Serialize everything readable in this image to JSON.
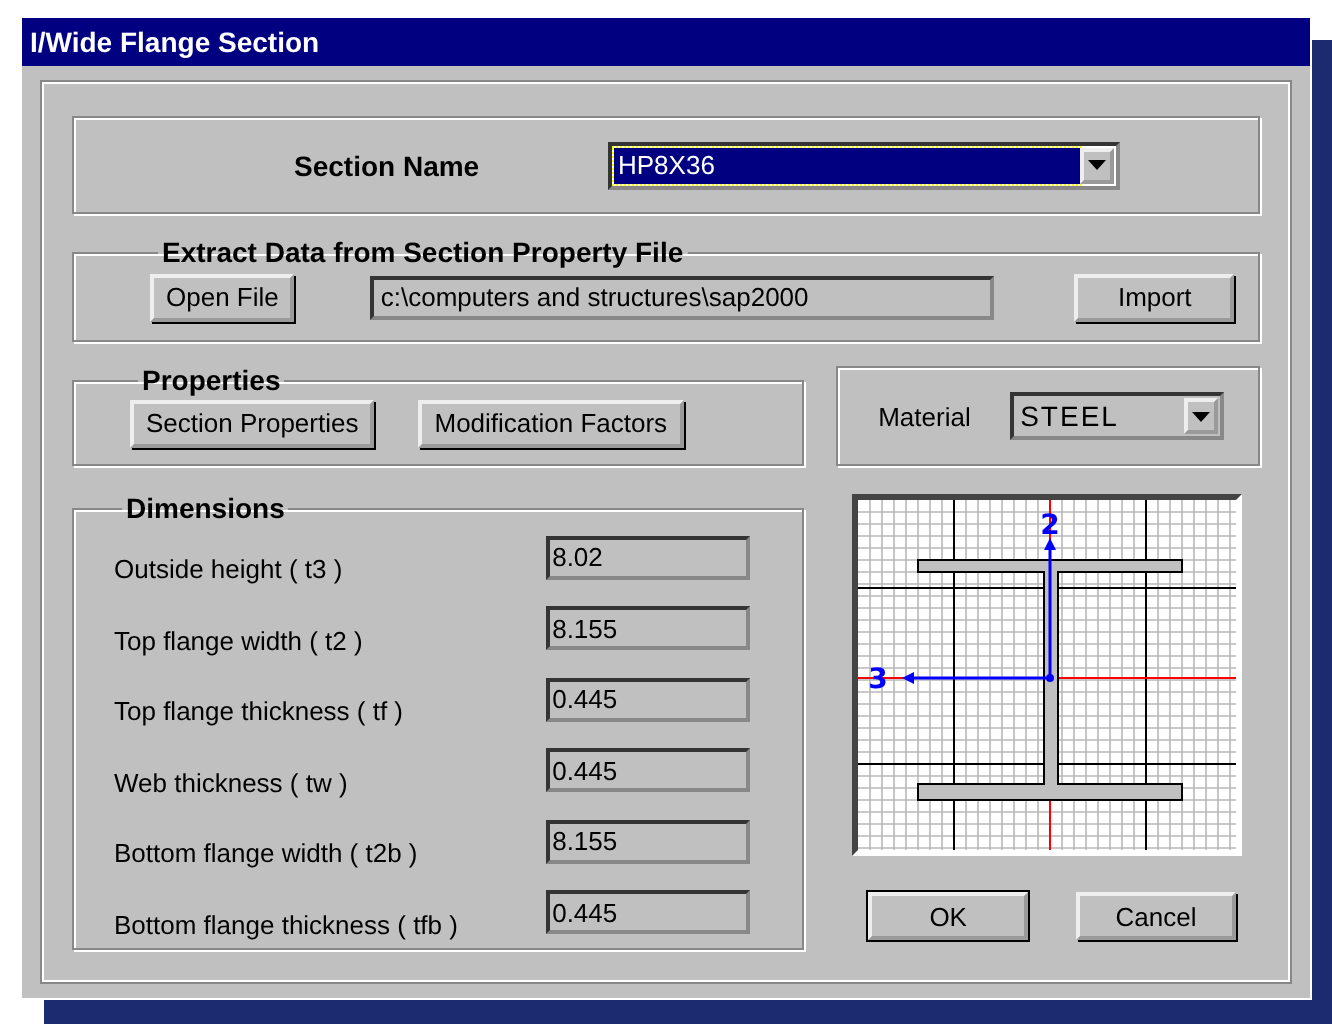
{
  "window": {
    "title": "I/Wide Flange Section"
  },
  "section_name": {
    "label": "Section Name",
    "value": "HP8X36",
    "focused": true
  },
  "extract": {
    "title": "Extract Data from Section Property File",
    "open_button": "Open File",
    "path": "c:\\computers and structures\\sap2000",
    "import_button": "Import"
  },
  "properties": {
    "title": "Properties",
    "buttons": [
      "Section Properties",
      "Modification Factors"
    ]
  },
  "material": {
    "label": "Material",
    "value": "STEEL"
  },
  "dimensions": {
    "title": "Dimensions",
    "rows": [
      {
        "label": "Outside height  ( t3 )",
        "value": "8.02"
      },
      {
        "label": "Top flange width  ( t2 )",
        "value": "8.155"
      },
      {
        "label": "Top flange thickness  ( tf )",
        "value": "0.445"
      },
      {
        "label": "Web thickness  ( tw )",
        "value": "0.445"
      },
      {
        "label": "Bottom flange width  ( t2b )",
        "value": "8.155"
      },
      {
        "label": "Bottom flange thickness  ( tfb )",
        "value": "0.445"
      }
    ]
  },
  "preview": {
    "axis_2": "2",
    "axis_3": "3"
  },
  "buttons": [
    {
      "label": "OK",
      "default": true
    },
    {
      "label": "Cancel",
      "default": false
    }
  ]
}
